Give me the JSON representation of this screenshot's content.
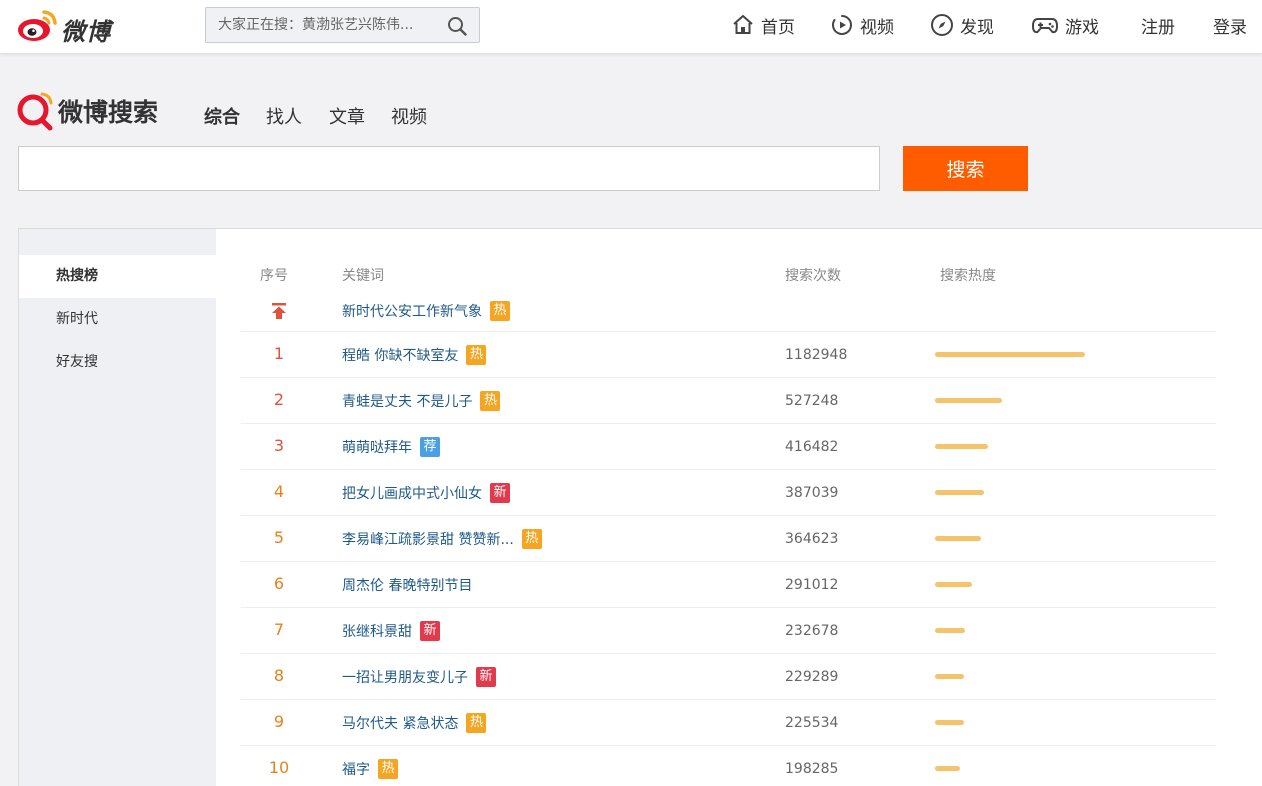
{
  "topnav": {
    "logo_text": "微博",
    "search_placeholder": "大家正在搜：黄渤张艺兴陈伟...",
    "items": [
      {
        "label": "首页",
        "icon": "home-icon"
      },
      {
        "label": "视频",
        "icon": "video-icon"
      },
      {
        "label": "发现",
        "icon": "compass-icon"
      },
      {
        "label": "游戏",
        "icon": "gamepad-icon"
      }
    ],
    "register": "注册",
    "login": "登录"
  },
  "search": {
    "logo_text": "微博搜索",
    "tabs": [
      "综合",
      "找人",
      "文章",
      "视频"
    ],
    "active_tab": 0,
    "input_value": "",
    "button_label": "搜索"
  },
  "sidebar": {
    "items": [
      "热搜榜",
      "新时代",
      "好友搜"
    ],
    "active": 0
  },
  "table": {
    "headers": {
      "rank": "序号",
      "keyword": "关键词",
      "count": "搜索次数",
      "heat": "搜索热度"
    },
    "pinned": {
      "keyword": "新时代公安工作新气象",
      "badge": "热"
    },
    "rows": [
      {
        "rank": "1",
        "keyword": "程皓 你缺不缺室友",
        "badge": "热",
        "count": "1182948"
      },
      {
        "rank": "2",
        "keyword": "青蛙是丈夫 不是儿子",
        "badge": "热",
        "count": "527248"
      },
      {
        "rank": "3",
        "keyword": "萌萌哒拜年",
        "badge": "荐",
        "count": "416482"
      },
      {
        "rank": "4",
        "keyword": "把女儿画成中式小仙女",
        "badge": "新",
        "count": "387039"
      },
      {
        "rank": "5",
        "keyword": "李易峰江疏影景甜 赞赞新...",
        "badge": "热",
        "count": "364623"
      },
      {
        "rank": "6",
        "keyword": "周杰伦 春晚特别节目",
        "badge": "",
        "count": "291012"
      },
      {
        "rank": "7",
        "keyword": "张继科景甜",
        "badge": "新",
        "count": "232678"
      },
      {
        "rank": "8",
        "keyword": "一招让男朋友变儿子",
        "badge": "新",
        "count": "229289"
      },
      {
        "rank": "9",
        "keyword": "马尔代夫 紧急状态",
        "badge": "热",
        "count": "225534"
      },
      {
        "rank": "10",
        "keyword": "福字",
        "badge": "热",
        "count": "198285"
      }
    ]
  },
  "colors": {
    "accent": "#ff5c00",
    "rank_top3": "#e0523a",
    "rank_rest": "#e8811a",
    "badge_hot": "#f4a623",
    "badge_new": "#e23a4d",
    "badge_rec": "#4aa0e0",
    "heat_bar": "#f5c46a",
    "keyword": "#1f5a8a"
  }
}
